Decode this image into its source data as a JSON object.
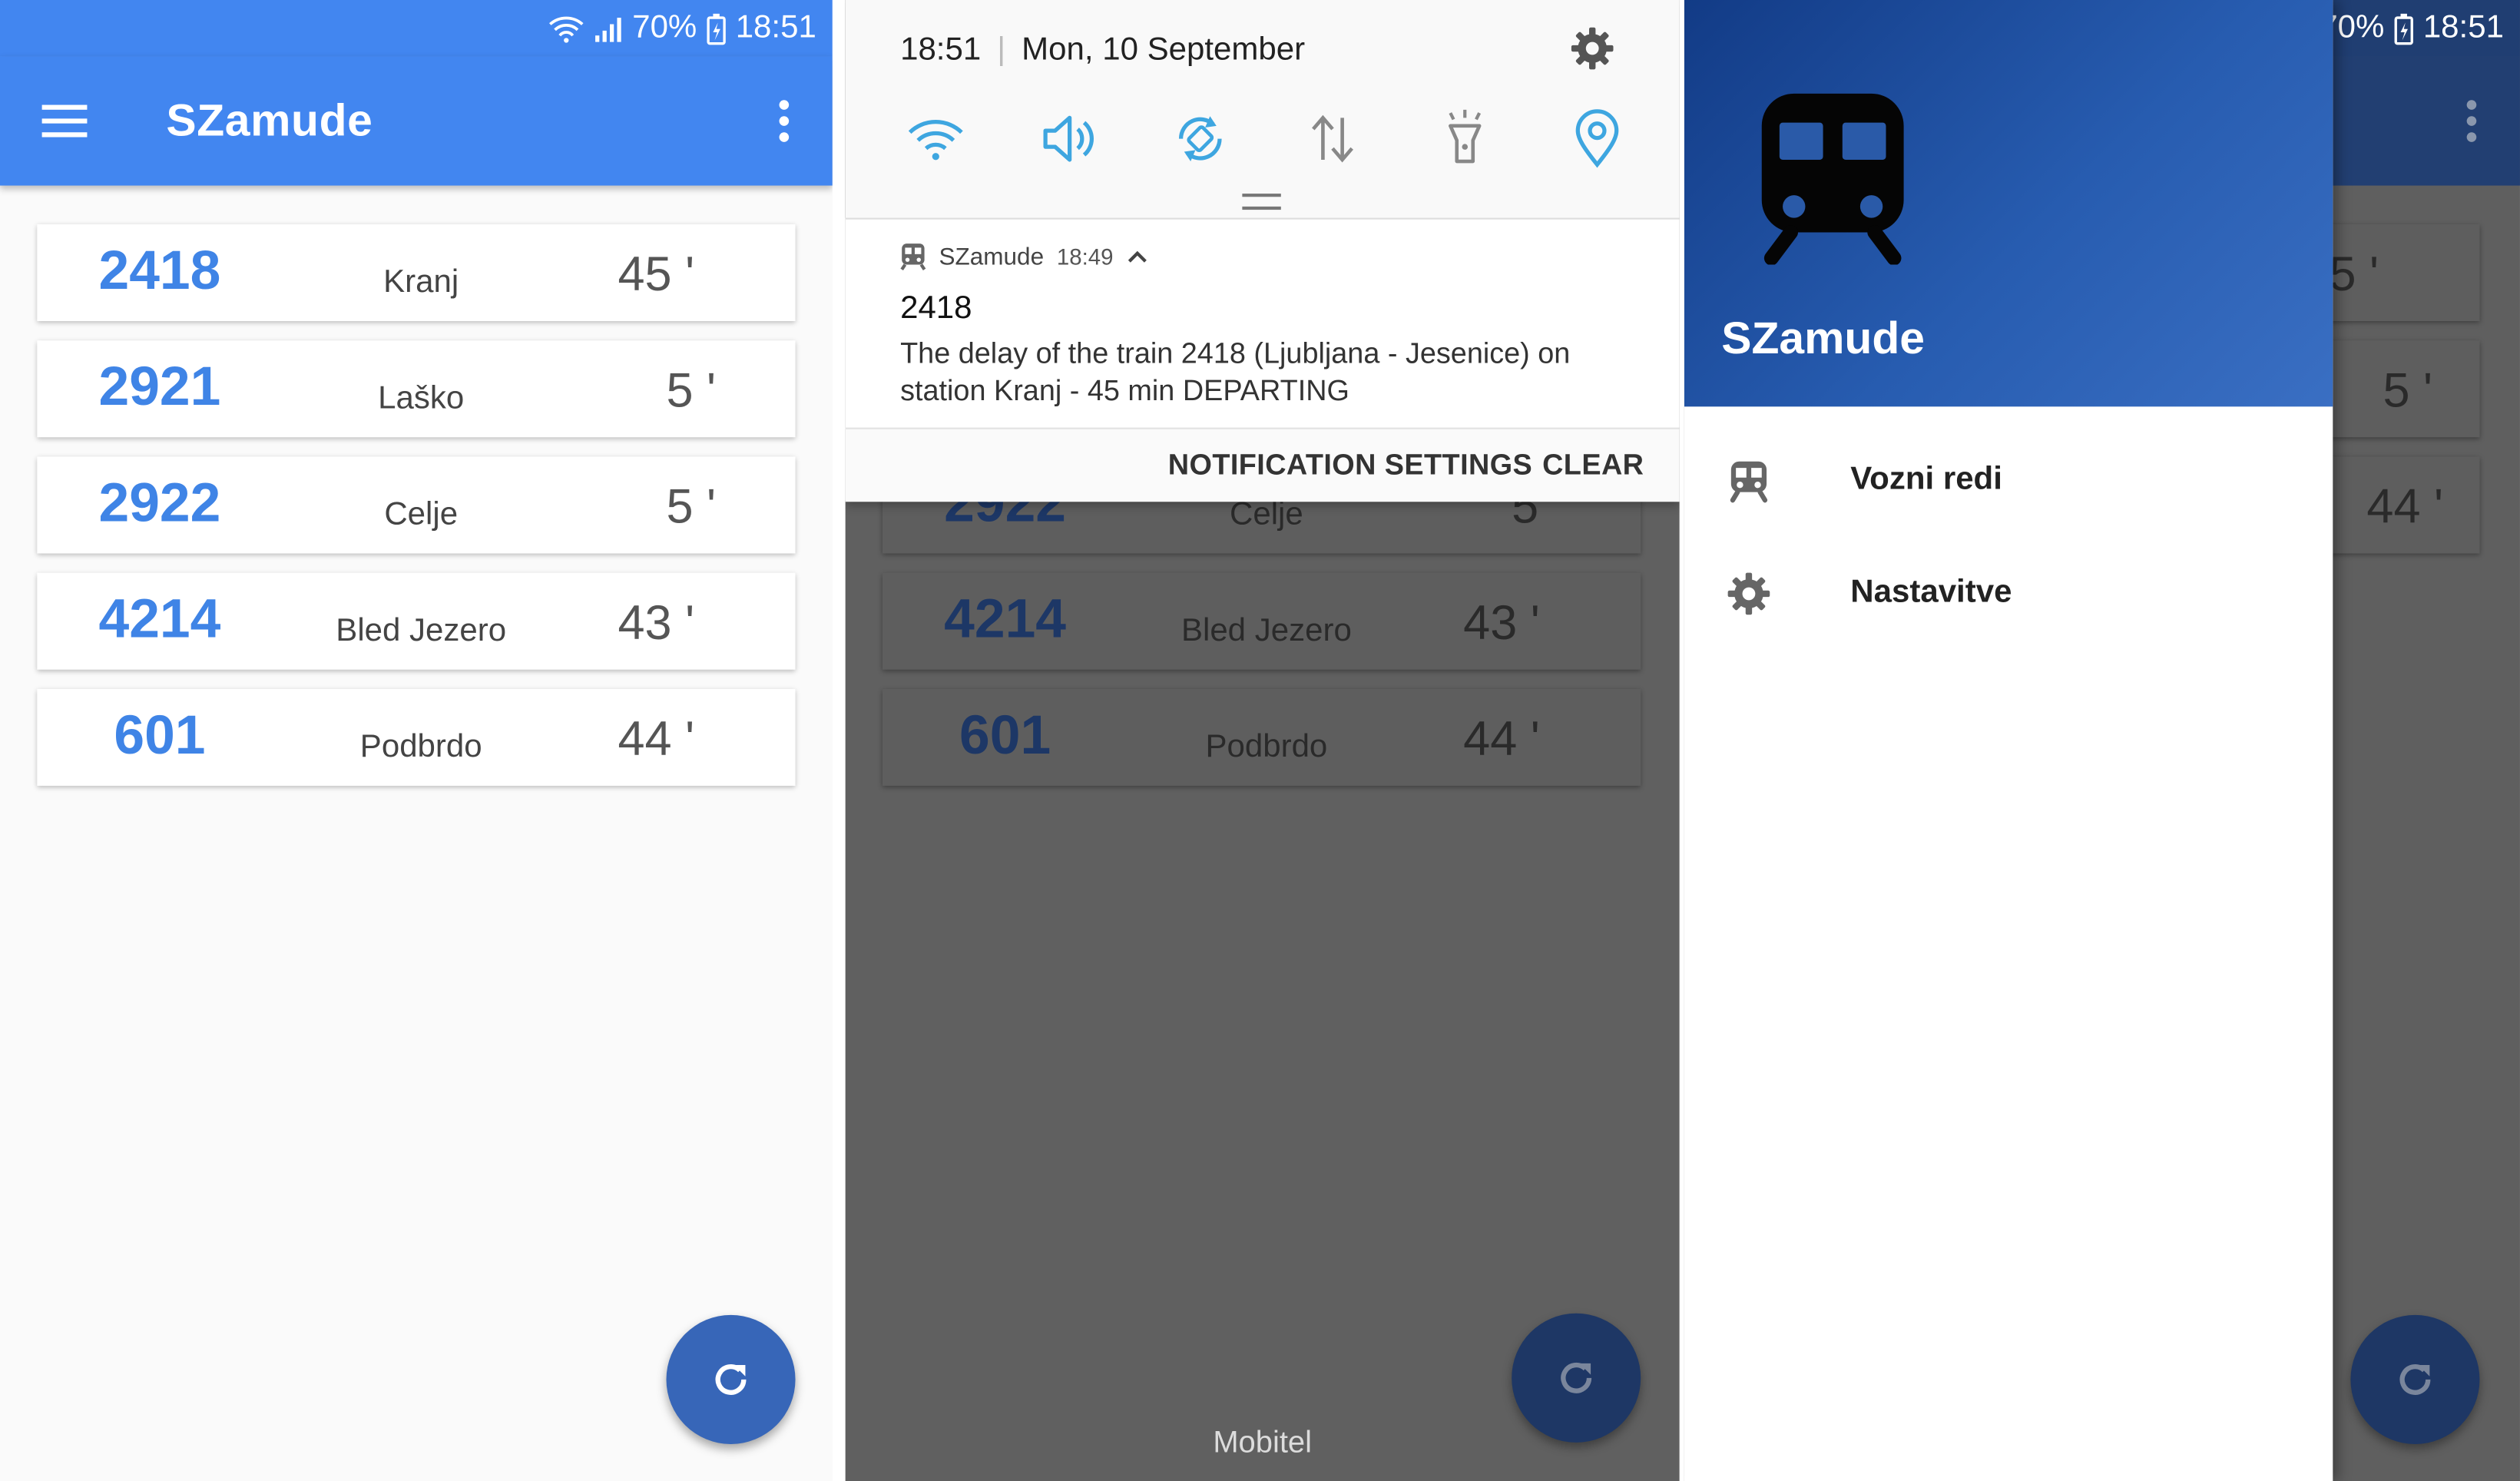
{
  "status_bar": {
    "battery": "70%",
    "time": "18:51"
  },
  "app": {
    "title": "SZamude"
  },
  "trains": [
    {
      "number": "2418",
      "station": "Kranj",
      "delay": "45 '"
    },
    {
      "number": "2921",
      "station": "Laško",
      "delay": "5 '"
    },
    {
      "number": "2922",
      "station": "Celje",
      "delay": "5 '"
    },
    {
      "number": "4214",
      "station": "Bled Jezero",
      "delay": "43 '"
    },
    {
      "number": "601",
      "station": "Podbrdo",
      "delay": "44 '"
    }
  ],
  "quick_settings": {
    "time": "18:51",
    "date": "Mon, 10 September",
    "icons": [
      "wifi-icon",
      "sound-icon",
      "auto-rotate-icon",
      "mobile-data-icon",
      "flashlight-icon",
      "location-icon"
    ],
    "accent": "#3ea6e0"
  },
  "notification": {
    "app_name": "SZamude",
    "time": "18:49",
    "title": "2418",
    "text": "The delay of the train 2418 (Ljubljana - Jesenice) on station Kranj -  45  min DEPARTING",
    "action_settings": "NOTIFICATION SETTINGS",
    "action_clear": "CLEAR"
  },
  "carrier": "Mobitel",
  "drawer": {
    "title": "SZamude",
    "items": [
      {
        "label": "Vozni redi",
        "icon": "train-icon"
      },
      {
        "label": "Nastavitve",
        "icon": "gear-icon"
      }
    ]
  },
  "colors": {
    "primary": "#4286f0",
    "train_number": "#3f84e6",
    "fab": "#3766b8"
  }
}
